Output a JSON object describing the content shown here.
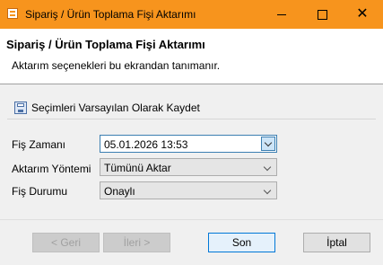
{
  "window": {
    "title": "Sipariş / Ürün Toplama Fişi Aktarımı"
  },
  "header": {
    "title": "Sipariş / Ürün Toplama Fişi Aktarımı",
    "description": "Aktarım seçenekleri bu ekrandan tanımanır."
  },
  "toolbar": {
    "save_defaults_label": "Seçimleri Varsayılan Olarak Kaydet"
  },
  "form": {
    "date_label": "Fiş Zamanı",
    "date_value": "05.01.2026 13:53",
    "method_label": "Aktarım Yöntemi",
    "method_value": "Tümünü Aktar",
    "status_label": "Fiş Durumu",
    "status_value": "Onaylı"
  },
  "buttons": {
    "back": "< Geri",
    "next": "İleri >",
    "finish": "Son",
    "cancel": "İptal"
  }
}
